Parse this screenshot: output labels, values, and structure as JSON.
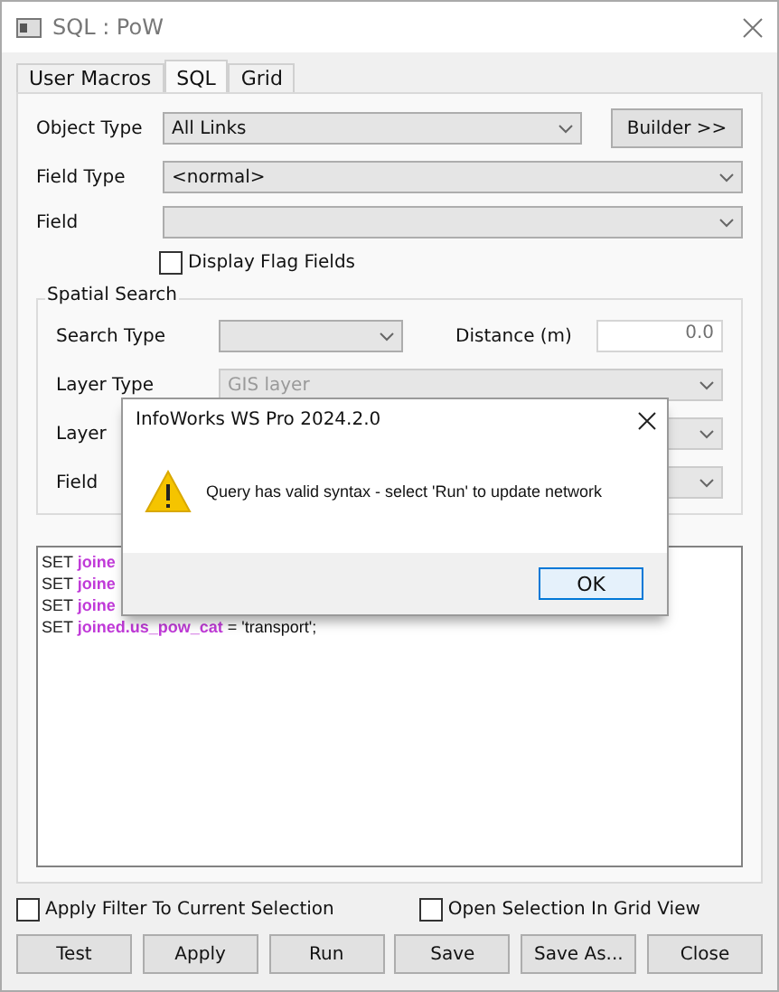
{
  "window": {
    "title": "SQL : PoW"
  },
  "tabs": [
    {
      "label": "User Macros",
      "selected": false
    },
    {
      "label": "SQL",
      "selected": true
    },
    {
      "label": "Grid",
      "selected": false
    }
  ],
  "object_type": {
    "label": "Object Type",
    "value": "All Links",
    "disabled": false
  },
  "builder_button": "Builder >>",
  "field_type": {
    "label": "Field Type",
    "value": "<normal>",
    "disabled": false
  },
  "field": {
    "label": "Field",
    "disabled": false
  },
  "display_flag_fields": {
    "label": "Display Flag Fields",
    "checked": false
  },
  "spatial_search": {
    "title": "Spatial Search",
    "search_type": {
      "label": "Search Type",
      "disabled": false
    },
    "distance": {
      "label": "Distance (m)",
      "value": "0.0"
    },
    "layer_type": {
      "label": "Layer Type",
      "value": "GIS layer",
      "disabled": true
    },
    "layer": {
      "label": "Layer",
      "disabled": true
    },
    "field": {
      "label": "Field",
      "disabled": true
    }
  },
  "sql_lines": [
    {
      "keyword": "SET",
      "field": "joine"
    },
    {
      "keyword": "SET",
      "field": "joine"
    },
    {
      "keyword": "SET",
      "field": "joine"
    },
    {
      "keyword": "SET",
      "field": "joined.us_pow_cat",
      "rest": " = 'transport';"
    }
  ],
  "options": [
    {
      "label": "Apply Filter To Current Selection",
      "checked": false
    },
    {
      "label": "Open Selection In Grid View",
      "checked": false
    }
  ],
  "buttons": [
    "Test",
    "Apply",
    "Run",
    "Save",
    "Save As...",
    "Close"
  ],
  "message_box": {
    "title": "InfoWorks WS Pro 2024.2.0",
    "message": "Query has valid syntax - select 'Run' to update network",
    "button": "OK"
  }
}
